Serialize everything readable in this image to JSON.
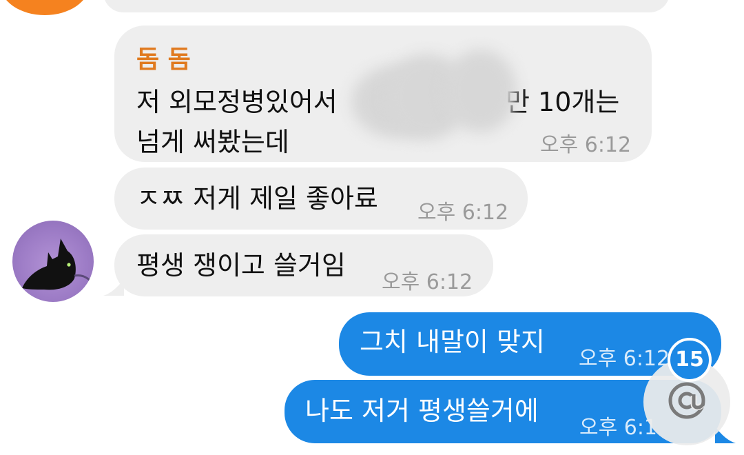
{
  "messages": [
    {
      "sender": "돔 돔",
      "line1_before": "저 외모정병있어서",
      "line1_after": "만 10개는",
      "line2": "넘게 써봤는데",
      "time": "오후 6:12"
    },
    {
      "text": "ㅈㅉ 저게 제일 좋아료",
      "time": "오후 6:12"
    },
    {
      "text": "평생 쟁이고 쓸거임",
      "time": "오후 6:12"
    },
    {
      "text": "그치 내말이 맞지",
      "time": "오후 6:12"
    },
    {
      "text": "나도 저거 평생쓸거에",
      "time": "오후 6:1"
    }
  ],
  "mention": {
    "count": "15",
    "icon": "at-icon"
  },
  "colors": {
    "incoming_bubble": "#eeeeee",
    "outgoing_bubble": "#1c88e5",
    "sender_name": "#e07a1f",
    "avatar_orange": "#f5821f",
    "avatar_purple": "#9d7cc6"
  }
}
